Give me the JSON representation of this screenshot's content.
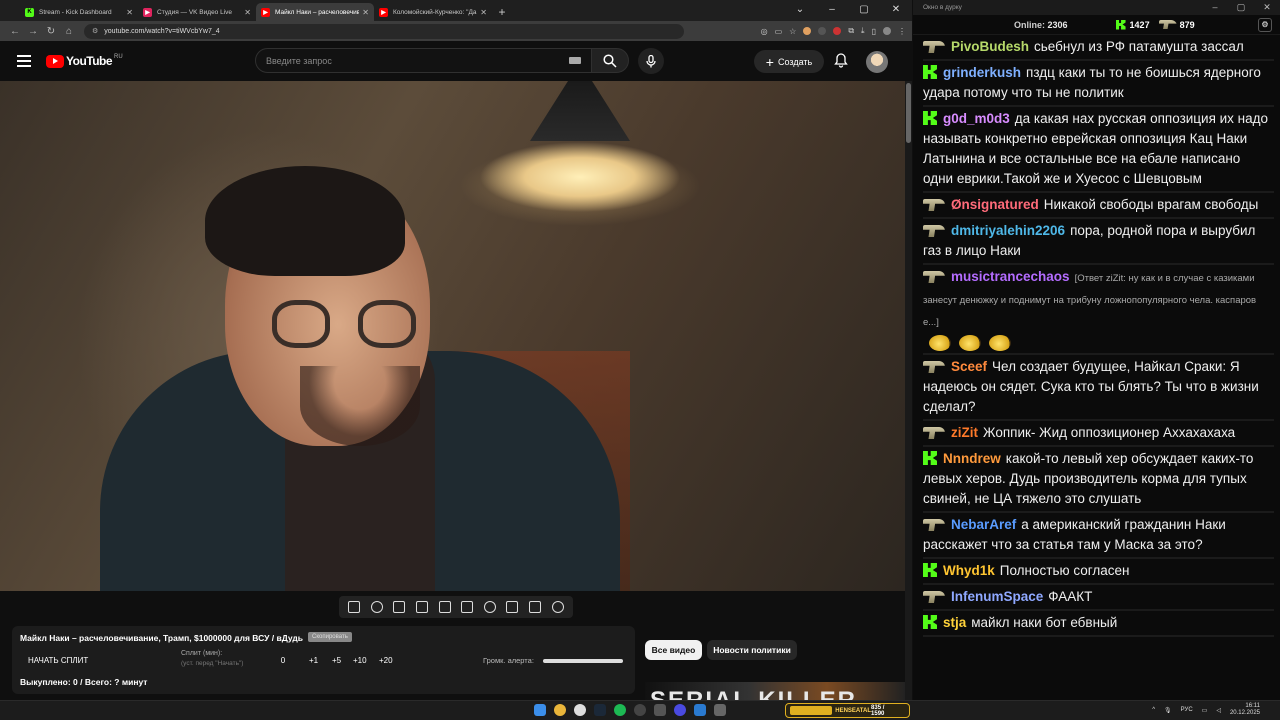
{
  "browser": {
    "tabs": [
      {
        "label": "Stream - Kick Dashboard",
        "favicon_color": "#53fc18",
        "favicon_glyph": "K"
      },
      {
        "label": "Студия — VK Видео Live",
        "favicon_color": "#e0245e",
        "favicon_glyph": "▶"
      },
      {
        "label": "Майкл Наки – расчеловечив",
        "favicon_color": "#ff0000",
        "favicon_glyph": "▶",
        "active": true
      },
      {
        "label": "Коломойский-Курченко: \"Да",
        "favicon_color": "#ff0000",
        "favicon_glyph": "▶"
      }
    ],
    "url": "youtube.com/watch?v=tiWVcbYw7_4",
    "window_controls": [
      "⌄",
      "–",
      "▢",
      "✕"
    ]
  },
  "youtube": {
    "logo_text": "YouTube",
    "country_code": "RU",
    "search_placeholder": "Введите запрос",
    "create_label": "Создать",
    "create_icon": "+",
    "video_title": "Майкл Наки – расчеловечивание, Трамп, $1000000 для ВСУ / вДудь",
    "title_badge": "Скопировать",
    "split": {
      "start_label": "НАЧАТЬ СПЛИТ",
      "split_label": "Сплит (мин):",
      "split_hint": "(уст. перед \"Начать\")",
      "value": "0",
      "increments": [
        "+1",
        "+5",
        "+10",
        "+20"
      ],
      "alert_label": "Громк. алерта:",
      "bought": "Выкуплено: 0 / Всего: ? минут"
    },
    "chips": [
      "Все видео",
      "Новости политики"
    ],
    "thumbnail_text": "SERIAL  KILLER"
  },
  "chat": {
    "window_title": "Окно в дурку",
    "online_label": "Online:",
    "online_count": "2306",
    "kick_count": "1427",
    "other_count": "879",
    "messages": [
      {
        "badge": "gun",
        "user": "PivoBudesh",
        "color": "#b6d96a",
        "text": "сьебнул из РФ патамушта зассал"
      },
      {
        "badge": "kick",
        "user": "grinderkush",
        "color": "#7fb0ff",
        "text": "пздц каки ты то не боишься ядерного удара потому что ты не политик"
      },
      {
        "badge": "kick",
        "user": "g0d_m0d3",
        "color": "#d88cff",
        "text": "да какая нах русская оппозиция их надо называть конкретно еврейская оппозиция Кац Наки Латынина и все остальные все на ебале написано одни еврики.Такой же и Хуесос с Шевцовым"
      },
      {
        "badge": "gun",
        "user": "Ønsignatured",
        "color": "#ff6b7a",
        "text": "Никакой свободы врагам свободы"
      },
      {
        "badge": "gun",
        "user": "dmitriyalehin2206",
        "color": "#4fb8e8",
        "text": "пора, родной пора и вырубил газ в лицо Наки"
      },
      {
        "badge": "gun",
        "user": "musictrancechaos",
        "color": "#b46cff",
        "reply": "[Ответ ziZit: ну как и в случае с казиками занесут денюжку и поднимут на трибуну ложнопопулярного чела. каспаров е...]",
        "text": "",
        "emotes": 3
      },
      {
        "badge": "gun",
        "user": "Sceef",
        "color": "#ff8a3d",
        "text": "Чел создает будущее, Найкал Сраки: Я надеюсь он сядет. Сука кто ты блять? Ты что в жизни сделал?"
      },
      {
        "badge": "gun",
        "user": "ziZit",
        "color": "#ff7a2a",
        "text": "Жоппик- Жид оппозиционер Аххахахаха"
      },
      {
        "badge": "kick",
        "user": "Nnndrew",
        "color": "#ff9a3c",
        "text": "какой-то левый хер обсуждает каких-то левых херов. Дудь производитель корма для тупых свиней, не ЦА тяжело это слушать"
      },
      {
        "badge": "gun",
        "user": "NebarAref",
        "color": "#5a9cff",
        "text": "а американский гражданин Наки расскажет что за статья там у Маска за это?"
      },
      {
        "badge": "kick",
        "user": "Whyd1k",
        "color": "#ffc531",
        "text": "Полностью согласен"
      },
      {
        "badge": "gun",
        "user": "InfenumSpace",
        "color": "#8fa8ff",
        "text": "ФААКТ"
      },
      {
        "badge": "kick",
        "user": "stja",
        "color": "#ffd23a",
        "text": "майкл наки бот ебвный"
      }
    ]
  },
  "taskbar": {
    "widget_label": "HENSEATAL",
    "widget_value": "835 / 1590",
    "lang": "РУС",
    "time": "16:11",
    "date": "20.12.2025"
  }
}
